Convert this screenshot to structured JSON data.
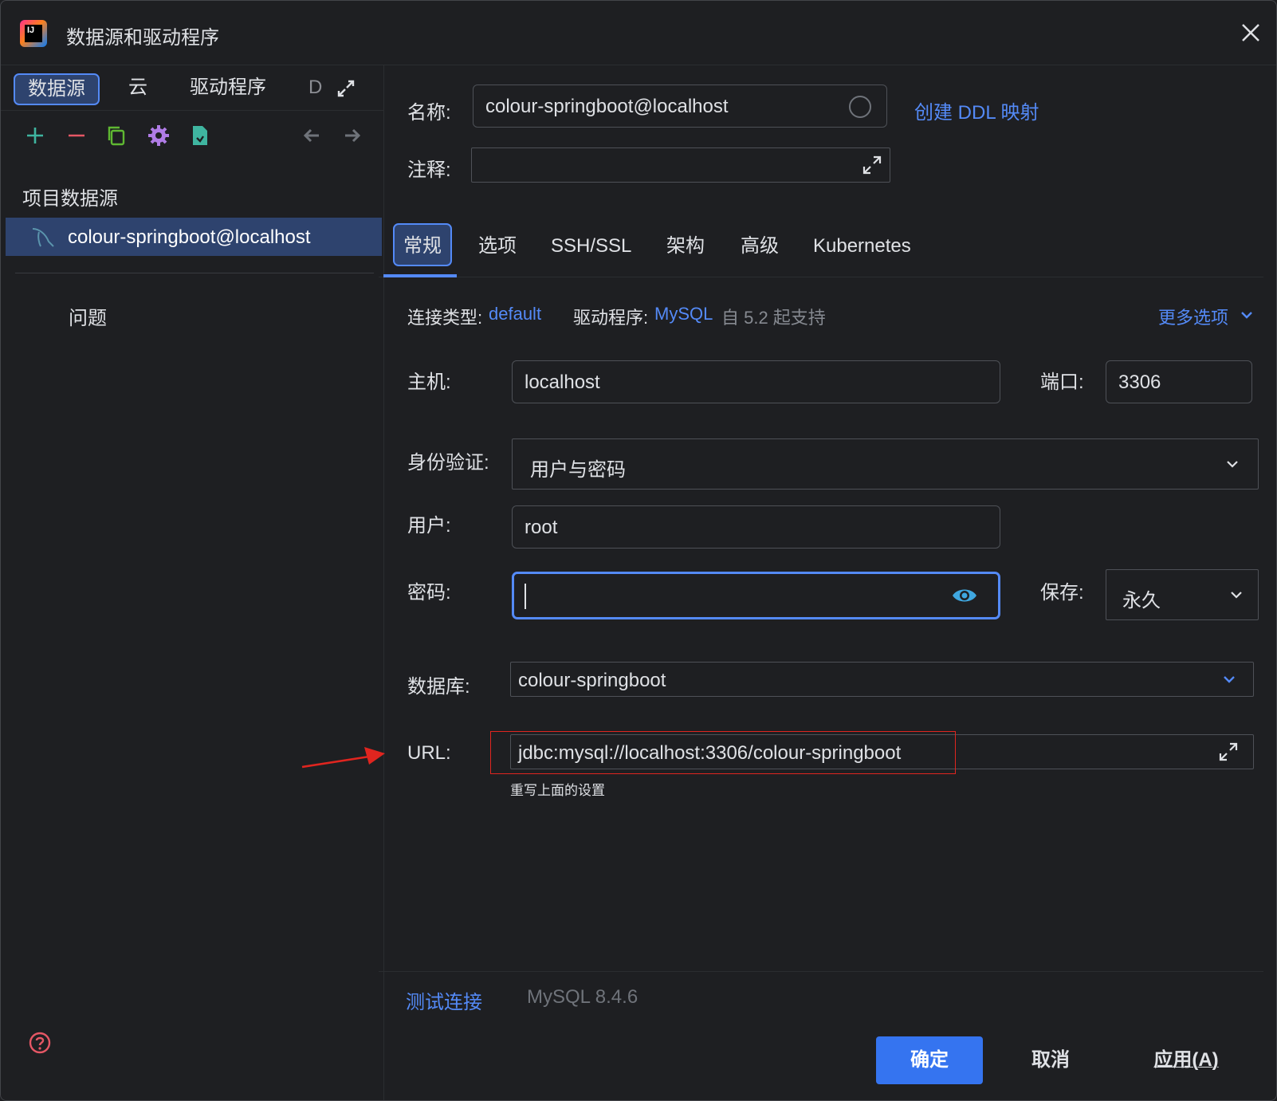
{
  "window": {
    "title": "数据源和驱动程序"
  },
  "left_tabs": [
    "数据源",
    "云",
    "驱动程序",
    "D"
  ],
  "left_toolbar": {
    "icons": [
      "add-icon",
      "remove-icon",
      "duplicate-icon",
      "settings-icon",
      "import-icon",
      "back-arrow-icon",
      "forward-arrow-icon"
    ]
  },
  "sidebar": {
    "section_title": "项目数据源",
    "items": [
      {
        "label": "colour-springboot@localhost"
      }
    ],
    "problems": "问题"
  },
  "form": {
    "name_label": "名称:",
    "name_value": "colour-springboot@localhost",
    "create_ddl_link": "创建 DDL 映射",
    "comment_label": "注释:",
    "comment_value": "",
    "tabs": [
      "常规",
      "选项",
      "SSH/SSL",
      "架构",
      "高级",
      "Kubernetes"
    ],
    "active_tab": "常规",
    "conn_type_label": "连接类型:",
    "conn_type_value": "default",
    "driver_label": "驱动程序:",
    "driver_value": "MySQL",
    "driver_note": "自 5.2 起支持",
    "more_options": "更多选项",
    "host_label": "主机:",
    "host_value": "localhost",
    "port_label": "端口:",
    "port_value": "3306",
    "auth_label": "身份验证:",
    "auth_value": "用户与密码",
    "user_label": "用户:",
    "user_value": "root",
    "password_label": "密码:",
    "password_value": "",
    "save_label": "保存:",
    "save_value": "永久",
    "database_label": "数据库:",
    "database_value": "colour-springboot",
    "url_label": "URL:",
    "url_value": "jdbc:mysql://localhost:3306/colour-springboot",
    "url_hint": "重写上面的设置"
  },
  "footer": {
    "test_connection": "测试连接",
    "server_version": "MySQL 8.4.6",
    "ok": "确定",
    "cancel": "取消",
    "apply": "应用(A)"
  },
  "colors": {
    "accent": "#548af7",
    "primary_button": "#3574f0",
    "annotation_red": "#e0251f",
    "background": "#1e1f22"
  }
}
